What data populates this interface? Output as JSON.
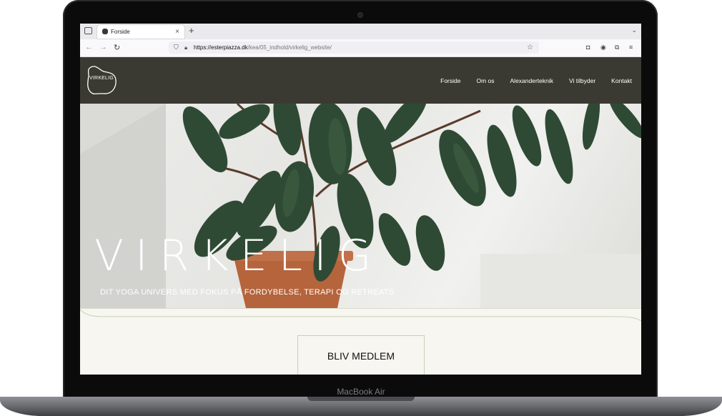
{
  "device": {
    "model_label": "MacBook Air"
  },
  "browser": {
    "tab_title": "Forside",
    "tab_close": "×",
    "new_tab": "+",
    "url_host": "https://esterpiazza.dk",
    "url_path": "/kea/05_indhold/virkelig_website/"
  },
  "site": {
    "logo_text": "VIRKELIG",
    "nav": [
      "Forside",
      "Om os",
      "Alexanderteknik",
      "Vi tilbyder",
      "Kontakt"
    ],
    "hero_title": "VIRKELIG",
    "hero_subtitle": "DIT YOGA UNIVERS MED FOKUS PÅ FORDYBELSE, TERAPI OG RETREATS",
    "cta_label": "BLIV MEDLEM"
  },
  "colors": {
    "header_bg": "#3a3a32",
    "page_bg": "#f7f6f1",
    "leaf_green": "#2f4a34",
    "pot": "#b5643c"
  }
}
